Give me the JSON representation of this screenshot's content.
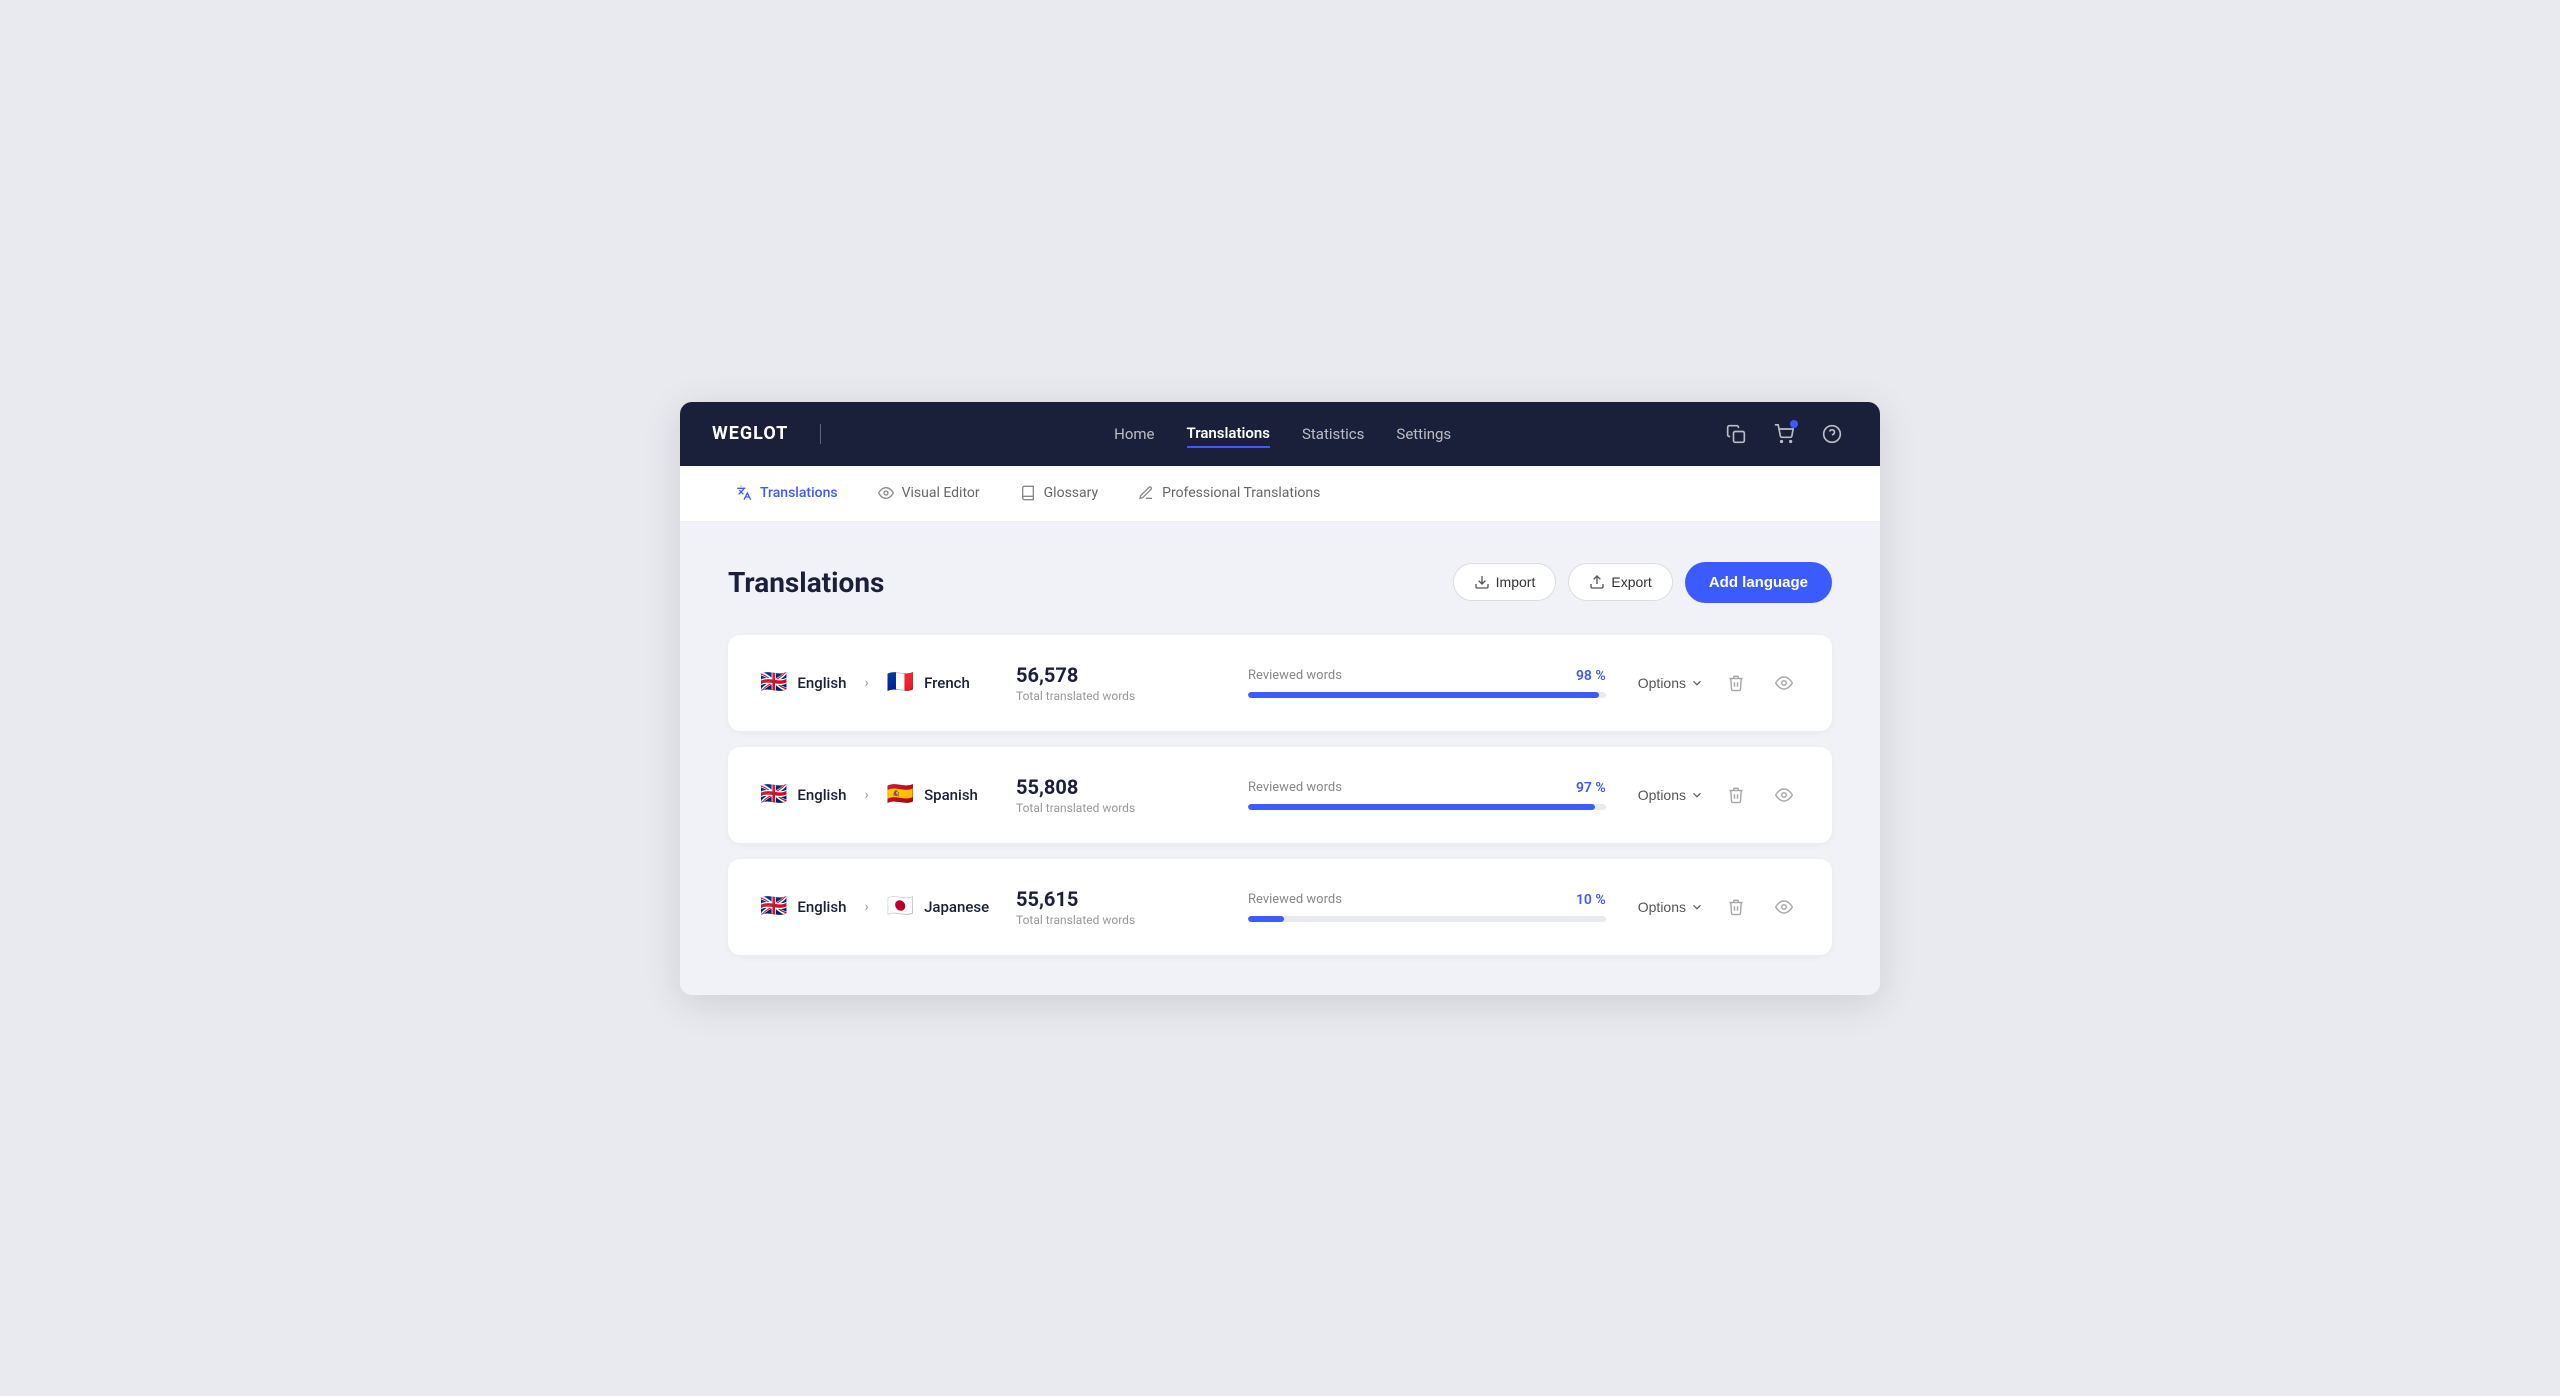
{
  "brand": {
    "logo": "WEGLOT"
  },
  "topNav": {
    "links": [
      {
        "label": "Home",
        "active": false
      },
      {
        "label": "Translations",
        "active": true
      },
      {
        "label": "Statistics",
        "active": false
      },
      {
        "label": "Settings",
        "active": false
      }
    ],
    "icons": [
      "copy-icon",
      "cart-icon",
      "help-icon"
    ],
    "badge_on": "cart-icon"
  },
  "subNav": {
    "items": [
      {
        "label": "Translations",
        "icon": "translate-icon",
        "active": true
      },
      {
        "label": "Visual Editor",
        "icon": "eye-icon",
        "active": false
      },
      {
        "label": "Glossary",
        "icon": "book-icon",
        "active": false
      },
      {
        "label": "Professional Translations",
        "icon": "pen-icon",
        "active": false
      }
    ]
  },
  "page": {
    "title": "Translations",
    "buttons": {
      "import": "Import",
      "export": "Export",
      "add_language": "Add language"
    }
  },
  "translations": [
    {
      "source_lang": "English",
      "source_flag": "🇬🇧",
      "target_lang": "French",
      "target_flag": "🇫🇷",
      "word_count": "56,578",
      "word_count_label": "Total translated words",
      "reviewed_label": "Reviewed words",
      "pct": "98 %",
      "pct_value": 98,
      "options_label": "Options"
    },
    {
      "source_lang": "English",
      "source_flag": "🇬🇧",
      "target_lang": "Spanish",
      "target_flag": "🇪🇸",
      "word_count": "55,808",
      "word_count_label": "Total translated words",
      "reviewed_label": "Reviewed words",
      "pct": "97 %",
      "pct_value": 97,
      "options_label": "Options"
    },
    {
      "source_lang": "English",
      "source_flag": "🇬🇧",
      "target_lang": "Japanese",
      "target_flag": "🇯🇵",
      "word_count": "55,615",
      "word_count_label": "Total translated words",
      "reviewed_label": "Reviewed words",
      "pct": "10 %",
      "pct_value": 10,
      "options_label": "Options"
    }
  ]
}
